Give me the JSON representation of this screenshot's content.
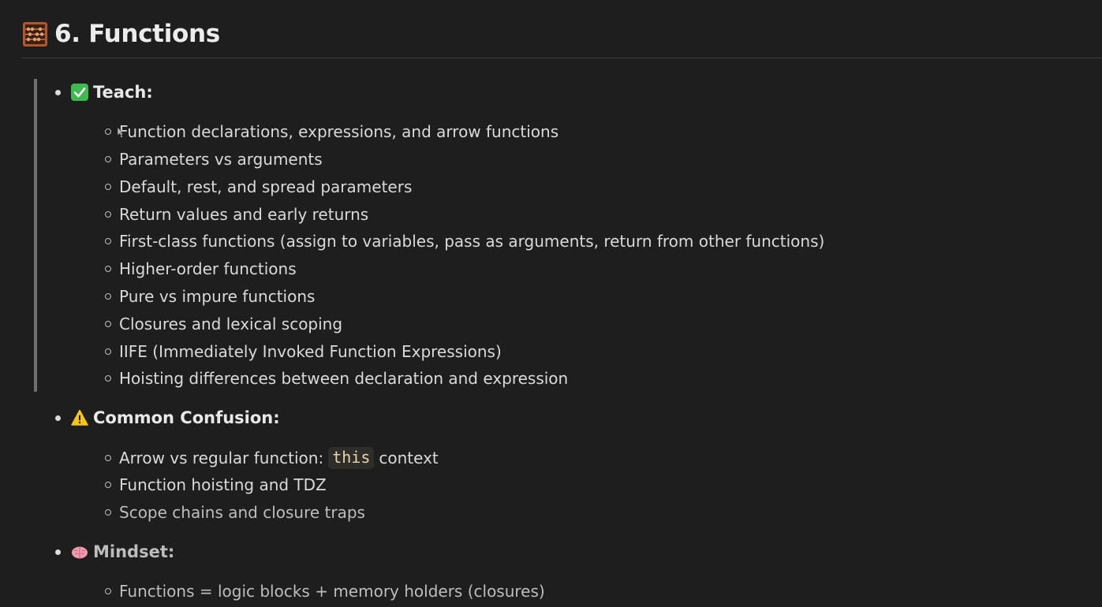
{
  "heading": {
    "icon": "abacus-icon",
    "title": "6. Functions"
  },
  "sections": [
    {
      "icon": "check-mark-icon",
      "label": "Teach:",
      "items": [
        "Function declarations, expressions, and arrow functions",
        "Parameters vs arguments",
        "Default, rest, and spread parameters",
        "Return values and early returns",
        "First-class functions (assign to variables, pass as arguments, return from other functions)",
        "Higher-order functions",
        "Pure vs impure functions",
        "Closures and lexical scoping",
        "IIFE (Immediately Invoked Function Expressions)",
        "Hoisting differences between declaration and expression"
      ]
    },
    {
      "icon": "warning-icon",
      "label": "Common Confusion:",
      "items": [
        {
          "before": "Arrow vs regular function:",
          "code": "this",
          "after": "context"
        },
        "Function hoisting and TDZ",
        "Scope chains and closure traps"
      ]
    },
    {
      "icon": "brain-icon",
      "label": "Mindset:",
      "items": [
        "Functions = logic blocks + memory holders (closures)"
      ]
    }
  ],
  "colors": {
    "background": "#1e1e1e",
    "text": "#dcdcdc",
    "quote_bar": "#6f6f6f",
    "code_text": "#e6d7a8",
    "code_background": "#2f2d29",
    "check_green": "#3fb950",
    "warning_yellow": "#f5c518",
    "brain_pink": "#f29bb0"
  }
}
